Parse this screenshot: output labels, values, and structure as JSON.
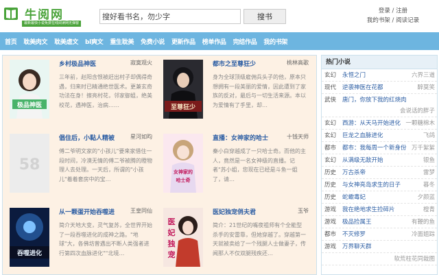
{
  "header": {
    "logo_text": "牛阅网",
    "logo_slogan": "最新最快小说免费在线阅读网无弹窗",
    "search": {
      "value": "",
      "placeholder": "搜好看书名，勿少字",
      "button_label": "搜书"
    },
    "user": {
      "login": "登录",
      "sep": " / ",
      "register": "注册",
      "bookshelf": "我的书架",
      "sep2": " / ",
      "history": "阅读记录"
    }
  },
  "nav": [
    "首页",
    "耽美肉文",
    "耽美虐文",
    "bl爽文",
    "重生耽美",
    "免费小说",
    "更新作品",
    "榜单作品",
    "完结作品",
    "我的书架"
  ],
  "books": [
    {
      "title": "乡村极品神医",
      "author": "寂寞观火",
      "desc": "三年前，赵阳含恨被赶出村子却偶得奇遇，归来时已精通绝世医术。更兼玄奇功法在身！擦亮村花，邻家御姐，绝美校花，遇神医，治病……",
      "cover_text": "极品神医",
      "cover_colors": [
        "#e9f6f2",
        "#bfe4d7"
      ]
    },
    {
      "title": "都市之至尊狂少",
      "author": "桃林高歌",
      "desc": "身为全球顶级雇佣兵头子的他，原本只想拥有一段美丽的爱情，因此遭到了家族的反对，最后与一切生活来源。本以为爱情有了手里，却…",
      "cover_text": "至尊狂少",
      "cover_colors": [
        "#2a2a30",
        "#6b1a1a"
      ]
    },
    {
      "title": "倡住后，小黏人精被",
      "author": "星河如昀",
      "desc": "傅二爷明文家的\"小孩儿\"要来家借住一段时间，冷漠无情的傅二爷被腾的瞪物理人去处理。一天后，所谓的\"小孩儿\"着着套房中的宝…",
      "cover_text": "58",
      "cover_colors": [
        "#ececec",
        "#e2e2e2"
      ]
    },
    {
      "title": "直播：女神家的哈士",
      "author": "十钱天师",
      "desc": "秦小白穿越成了一只哈士奇。而他的主人，竟然是一名女神级的直播。记者\"苏小姐，您现在已经是斗鱼一姐了，请…",
      "cover_text": "女神家的哈士奇",
      "cover_colors": [
        "#fbe8ef",
        "#f2c9d6"
      ]
    },
    {
      "title": "从一颗蛋开始吞噬进",
      "author": "王皇同仙",
      "desc": "简介天地大变，灵气复苏，全世界开始了一段吞噬进化的成神之路。\"地球\"大，各佛坊曾遇出不断人类强者进行第四次血脉进化\"\"北境…",
      "cover_text": "吞噬进化",
      "cover_colors": [
        "#0b1b3e",
        "#22508f"
      ]
    },
    {
      "title": "医妃独宠俏夫君",
      "author": "玉爷",
      "desc": "简介：21世纪的嘴夜祖师有个全能型杀手的安雷靠，但她穿越了。穿越第一天就被卖给了一个残腿人士做妻子，传闻那人不仅双腿残疾还…",
      "cover_text": "医妃独宠",
      "cover_colors": [
        "#f6e7e1",
        "#e7b9aa"
      ]
    }
  ],
  "sidebar": {
    "title": "热门小说",
    "items": [
      {
        "cat": "玄幻",
        "title": "永恒之门",
        "author": "六界三道"
      },
      {
        "cat": "现代",
        "title": "逆袭神医在花都",
        "author": "醉莫笑"
      },
      {
        "cat": "武侠",
        "title": "唐门，你放下我的红烧肉",
        "author": "会说话的胖子"
      },
      {
        "cat": "玄幻",
        "title": "西游：从天马开始进化",
        "author": "一颗糖棉木"
      },
      {
        "cat": "玄幻",
        "title": "巨龙之血脉进化",
        "author": "飞鸽"
      },
      {
        "cat": "都市",
        "title": "都市：我每周一个新身份",
        "author": "万千絮絮"
      },
      {
        "cat": "玄幻",
        "title": "从满级无敌开始",
        "author": "银鱼"
      },
      {
        "cat": "历史",
        "title": "万古杀帝",
        "author": "雷梦"
      },
      {
        "cat": "历史",
        "title": "与女神亮岛求生的日子",
        "author": "暮冬"
      },
      {
        "cat": "历史",
        "title": "蛇蠍毒妃",
        "author": "夕颜蓝"
      },
      {
        "cat": "游戏",
        "title": "我在绝地求生捡碎片",
        "author": "橙青"
      },
      {
        "cat": "游戏",
        "title": "极品捡属王",
        "author": "有鞭的鱼"
      },
      {
        "cat": "都市",
        "title": "不灭修罗",
        "author": "冷面姐踪"
      },
      {
        "cat": "游戏",
        "title": "万界聊天群",
        "author": ""
      },
      {
        "cat": "",
        "title": "",
        "author": "软荒柱花同栽图"
      }
    ]
  },
  "colors": {
    "nav_bg": "#6db5e0",
    "title_blue": "#2b5da3",
    "logo_green": "#4aa33a",
    "panel_bg": "#fdf1e4"
  }
}
